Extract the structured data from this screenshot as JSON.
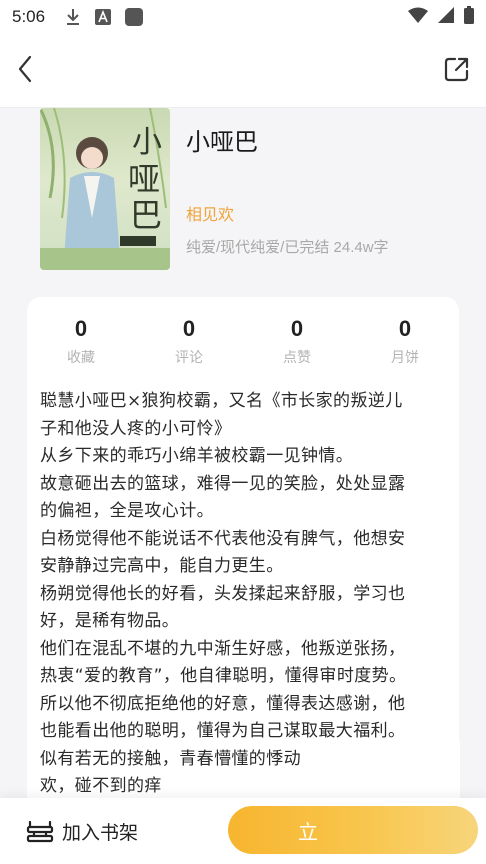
{
  "status_bar": {
    "time": "5:06",
    "icons": [
      "download-icon",
      "a-notification-icon",
      "app-square-icon",
      "wifi-icon",
      "signal-icon",
      "battery-icon"
    ]
  },
  "nav": {
    "back_icon": "chevron-left-icon",
    "share_icon": "share-icon"
  },
  "book": {
    "title": "小哑巴",
    "author": "相见欢",
    "meta": "纯爱/现代纯爱/已完结 24.4w字",
    "cover_text": "小哑巴"
  },
  "stats": [
    {
      "value": "0",
      "label": "收藏"
    },
    {
      "value": "0",
      "label": "评论"
    },
    {
      "value": "0",
      "label": "点赞"
    },
    {
      "value": "0",
      "label": "月饼"
    }
  ],
  "description": [
    "聪慧小哑巴×狼狗校霸，又名《市长家的叛逆儿",
    "子和他没人疼的小可怜》",
    "从乡下来的乖巧小绵羊被校霸一见钟情。",
    "故意砸出去的篮球，难得一见的笑脸，处处显露",
    "的偏袒，全是攻心计。",
    "白杨觉得他不能说话不代表他没有脾气，他想安",
    "安静静过完高中，能自力更生。",
    "杨朔觉得他长的好看，头发揉起来舒服，学习也",
    "好，是稀有物品。",
    "他们在混乱不堪的九中渐生好感，他叛逆张扬，",
    "热衷“爱的教育”，他自律聪明，懂得审时度势。",
    "所以他不彻底拒绝他的好意，懂得表达感谢，他",
    "也能看出他的聪明，懂得为自己谋取最大福利。",
    "似有若无的接触，青春懵懂的悸动",
    "欢，碰不到的痒"
  ],
  "bottom_bar": {
    "shelf_label": "加入书架",
    "read_label": "立"
  },
  "colors": {
    "accent": "#f0a43a",
    "button_gradient_start": "#f7b52f",
    "button_gradient_end": "#f7d57b"
  }
}
